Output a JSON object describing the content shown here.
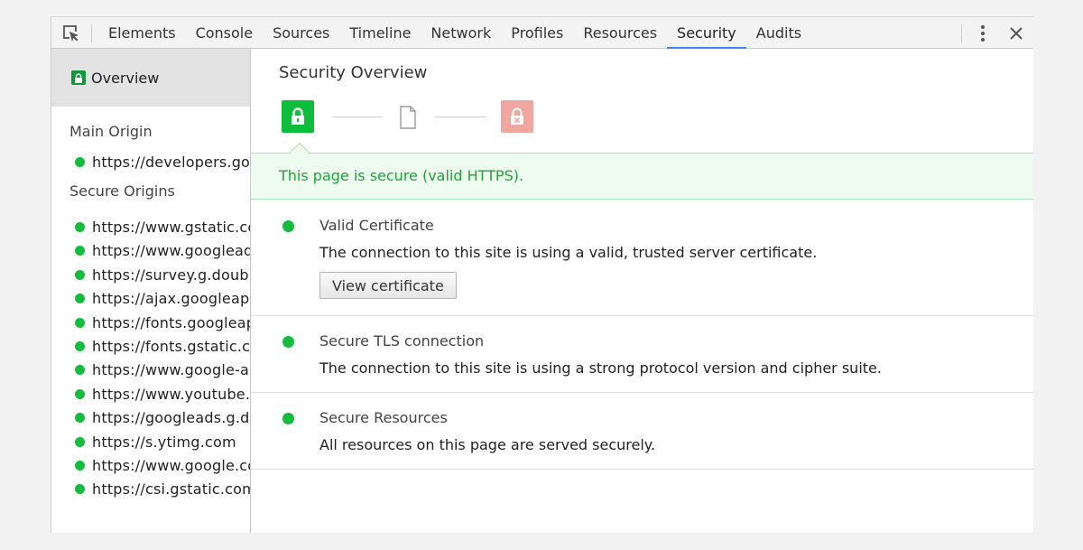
{
  "toolbar": {
    "tabs": [
      {
        "label": "Elements"
      },
      {
        "label": "Console"
      },
      {
        "label": "Sources"
      },
      {
        "label": "Timeline"
      },
      {
        "label": "Network"
      },
      {
        "label": "Profiles"
      },
      {
        "label": "Resources"
      },
      {
        "label": "Security",
        "active": true
      },
      {
        "label": "Audits"
      }
    ],
    "active_tab": "Security"
  },
  "sidebar": {
    "overview_label": "Overview",
    "main_origin_heading": "Main Origin",
    "main_origin": "https://developers.goo",
    "secure_origins_heading": "Secure Origins",
    "secure_origins": [
      "https://www.gstatic.co",
      "https://www.googleads",
      "https://survey.g.doubl",
      "https://ajax.googleapi",
      "https://fonts.googleap",
      "https://fonts.gstatic.co",
      "https://www.google-ar",
      "https://www.youtube.c",
      "https://googleads.g.do",
      "https://s.ytimg.com",
      "https://www.google.co",
      "https://csi.gstatic.com"
    ]
  },
  "main": {
    "title": "Security Overview",
    "summary_text": "This page is secure (valid HTTPS).",
    "explanations": [
      {
        "title": "Valid Certificate",
        "description": "The connection to this site is using a valid, trusted server certificate.",
        "button_label": "View certificate"
      },
      {
        "title": "Secure TLS connection",
        "description": "The connection to this site is using a strong protocol version and cipher suite."
      },
      {
        "title": "Secure Resources",
        "description": "All resources on this page are served securely."
      }
    ]
  },
  "colors": {
    "secure_green": "#0bbf3a",
    "insecure_red": "#f2a6a0",
    "active_tab_underline": "#3e82f7",
    "banner_text": "#1ea53a"
  },
  "icons": {
    "inspect": "inspect-element-icon",
    "menu": "more-vertical-icon",
    "close": "close-icon",
    "secure": "lock-icon",
    "neutral": "document-icon",
    "insecure": "insecure-lock-icon"
  }
}
